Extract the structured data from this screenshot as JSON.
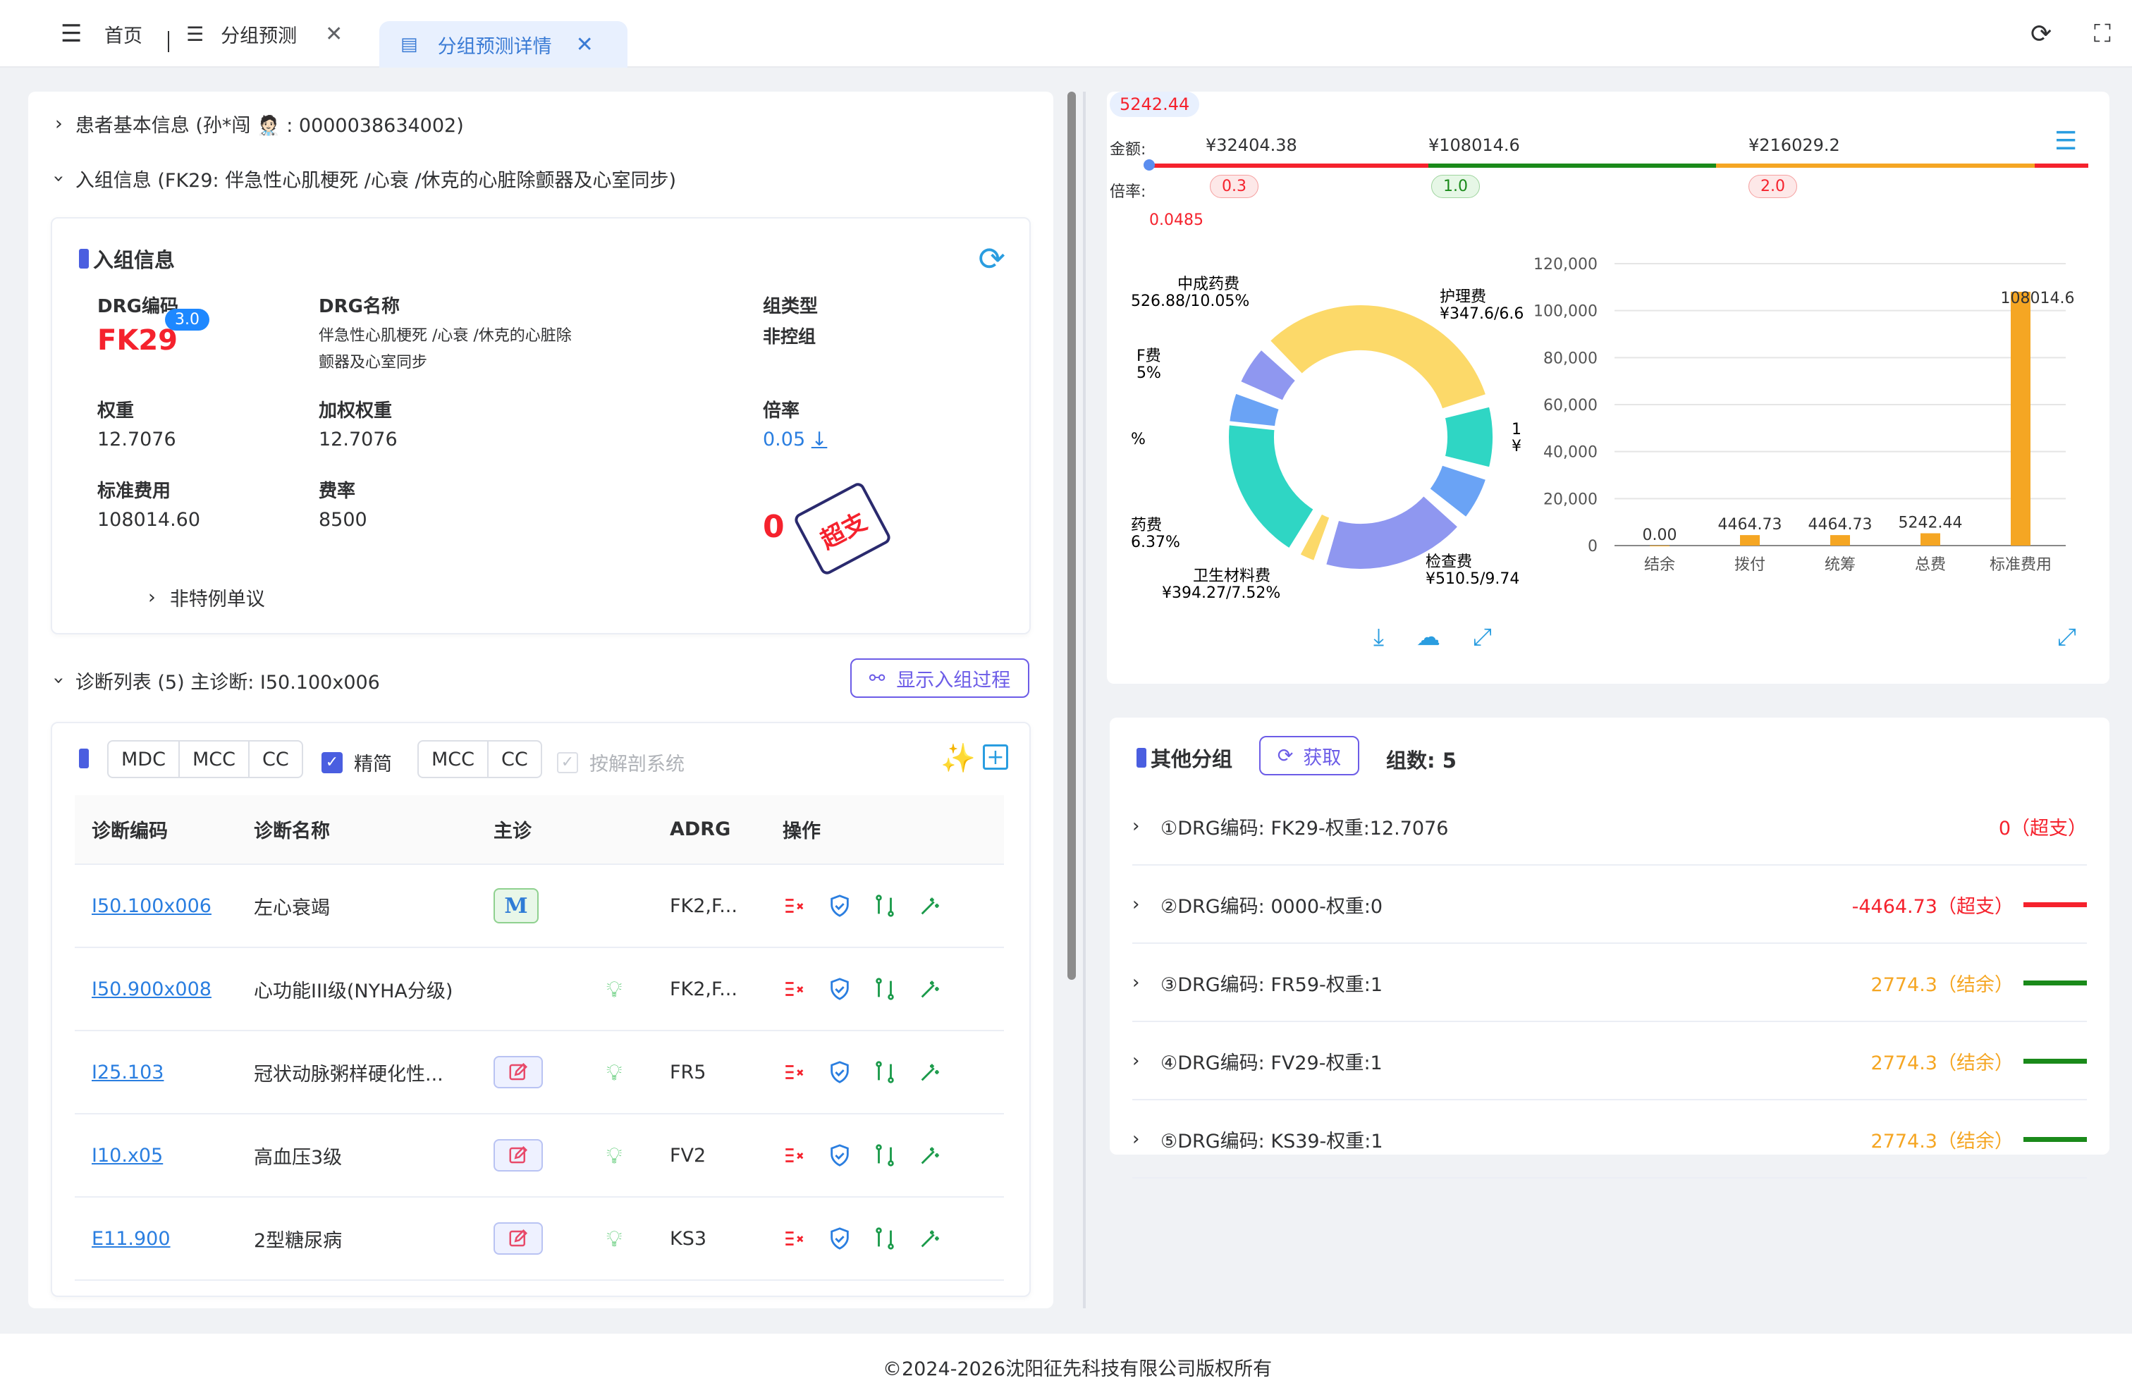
{
  "tabs": {
    "home": "首页",
    "group": "分组预测",
    "detail": "分组预测详情"
  },
  "patient": {
    "basic": "患者基本信息 (孙*闯 🧑🏻‍⚕️ : 0000038634002)",
    "admit": "入组信息 (FK29: 伴急性心肌梗死 /心衰 /休克的心脏除颤器及心室同步)"
  },
  "admission": {
    "title": "入组信息",
    "drg_code_label": "DRG编码",
    "drg_code": "FK29",
    "version": "3.0",
    "drg_name_label": "DRG名称",
    "drg_name_1": "伴急性心肌梗死 /心衰 /休克的心脏除",
    "drg_name_2": "颤器及心室同步",
    "type_label": "组类型",
    "type": "非控组",
    "weight_label": "权重",
    "weight": "12.7076",
    "wweight_label": "加权权重",
    "wweight": "12.7076",
    "ratio_label": "倍率",
    "ratio": "0.05",
    "stdcost_label": "标准费用",
    "stdcost": "108014.60",
    "rate_label": "费率",
    "rate": "8500",
    "result": "0",
    "stamp": "超支",
    "non_special": "非特例单议"
  },
  "diag": {
    "head": "诊断列表 (5) 主诊断: I50.100x006",
    "show_btn": "显示入组过程",
    "seg1": [
      "MDC",
      "MCC",
      "CC"
    ],
    "simplify": "精简",
    "seg2": [
      "MCC",
      "CC"
    ],
    "anatomy": "按解剖系统",
    "columns": [
      "诊断编码",
      "诊断名称",
      "主诊",
      "",
      "ADRG",
      "操作"
    ],
    "rows": [
      {
        "code": "I50.100x006",
        "name": "左心衰竭",
        "main": "M",
        "adrg": "FK2,F..."
      },
      {
        "code": "I50.900x008",
        "name": "心功能III级(NYHA分级)",
        "main": "",
        "adrg": "FK2,F..."
      },
      {
        "code": "I25.103",
        "name": "冠状动脉粥样硬化性...",
        "main": "edit",
        "adrg": "FR5"
      },
      {
        "code": "I10.x05",
        "name": "高血压3级",
        "main": "edit",
        "adrg": "FV2"
      },
      {
        "code": "E11.900",
        "name": "2型糖尿病",
        "main": "edit",
        "adrg": "KS3"
      }
    ]
  },
  "scale": {
    "current": "5242.44",
    "amount_label": "金额:",
    "ratio_label": "倍率:",
    "a1": "¥32404.38",
    "a2": "¥108014.6",
    "a3": "¥216029.2",
    "r1": "0.3",
    "r2": "1.0",
    "r3": "2.0",
    "low": "0.0485"
  },
  "donut": {
    "labels": [
      {
        "t1": "中成药费",
        "t2": "526.88/10.05%"
      },
      {
        "t1": "护理费",
        "t2": "¥347.6/6.6"
      },
      {
        "t1": "F费",
        "t2": "5%"
      },
      {
        "t1": "药费",
        "t2": "6.37%"
      },
      {
        "t1": "卫生材料费",
        "t2": "¥394.27/7.52%"
      },
      {
        "t1": "检查费",
        "t2": "¥510.5/9.74"
      },
      {
        "t1": "1",
        "t2": "¥"
      },
      {
        "t1": "%",
        "t2": "%"
      }
    ]
  },
  "chart_data": {
    "type": "bar",
    "categories": [
      "结余",
      "拨付",
      "统筹",
      "总费",
      "标准费用"
    ],
    "values": [
      0.0,
      4464.73,
      4464.73,
      5242.44,
      108014.6
    ],
    "value_labels": [
      "0.00",
      "4464.73",
      "4464.73",
      "5242.44",
      "108014.6"
    ],
    "ylim": [
      0,
      120000
    ],
    "yticks": [
      "0",
      "20,000",
      "40,000",
      "60,000",
      "80,000",
      "100,000",
      "120,000"
    ],
    "bar_color": "#f5a623"
  },
  "other": {
    "title": "其他分组",
    "fetch": "获取",
    "count": "组数: 5",
    "rows": [
      {
        "label": "①DRG编码: FK29-权重:12.7076",
        "value": "0（超支）",
        "color": "#f5222d",
        "line": ""
      },
      {
        "label": "②DRG编码: 0000-权重:0",
        "value": "-4464.73（超支）",
        "color": "#f5222d",
        "line": "#f5222d"
      },
      {
        "label": "③DRG编码: FR59-权重:1",
        "value": "2774.3（结余）",
        "color": "#f5a623",
        "line": "#1a8a1a"
      },
      {
        "label": "④DRG编码: FV29-权重:1",
        "value": "2774.3（结余）",
        "color": "#f5a623",
        "line": "#1a8a1a"
      },
      {
        "label": "⑤DRG编码: KS39-权重:1",
        "value": "2774.3（结余）",
        "color": "#f5a623",
        "line": "#1a8a1a"
      }
    ]
  },
  "footer": "©2024-2026沈阳征先科技有限公司版权所有"
}
